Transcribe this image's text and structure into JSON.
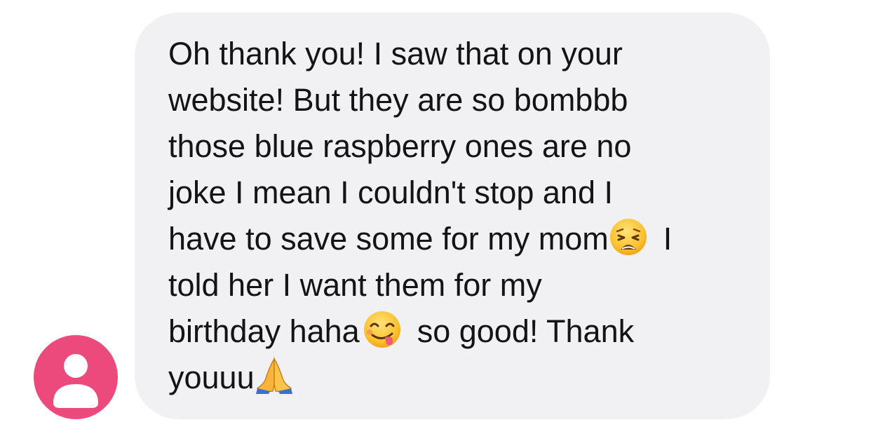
{
  "conversation": {
    "sender": {
      "avatar_icon": "person-icon",
      "avatar_color": "#ec4a7d"
    },
    "message": {
      "bubble_color": "#f1f1f4",
      "text_color": "#141414",
      "lines": [
        "Oh thank you! I saw that on your",
        "website! But they are so bombbb",
        "those blue raspberry ones are no",
        "joke I mean I couldn't stop and I",
        "have to save some for my mom",
        "I",
        "told her I want them for my",
        "birthday haha",
        "so good! Thank",
        "youuu"
      ],
      "emojis": [
        "weary-face-emoji",
        "savoring-food-emoji",
        "folded-hands-emoji"
      ]
    }
  }
}
